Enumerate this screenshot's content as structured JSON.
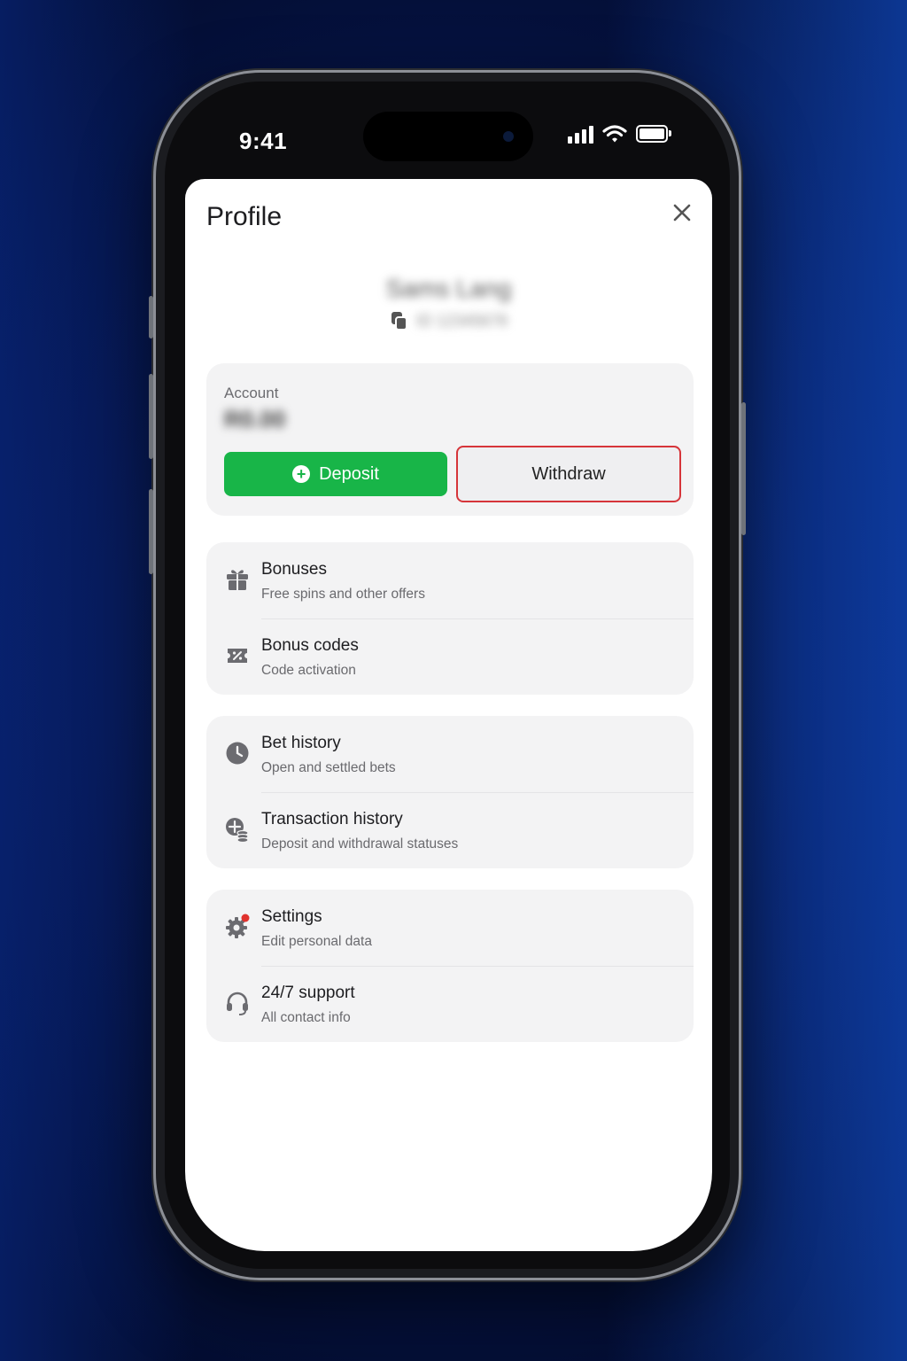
{
  "status_bar": {
    "time": "9:41"
  },
  "profile": {
    "title": "Profile",
    "user_name": "Sams Lang",
    "user_id": "ID 12345678"
  },
  "account": {
    "label": "Account",
    "balance": "R0.00",
    "deposit_label": "Deposit",
    "withdraw_label": "Withdraw"
  },
  "groups": [
    {
      "items": [
        {
          "icon": "gift-icon",
          "title": "Bonuses",
          "subtitle": "Free spins and other offers"
        },
        {
          "icon": "coupon-icon",
          "title": "Bonus codes",
          "subtitle": "Code activation"
        }
      ]
    },
    {
      "items": [
        {
          "icon": "clock-icon",
          "title": "Bet history",
          "subtitle": "Open and settled bets"
        },
        {
          "icon": "coins-icon",
          "title": "Transaction history",
          "subtitle": "Deposit and withdrawal statuses"
        }
      ]
    },
    {
      "items": [
        {
          "icon": "gear-icon",
          "title": "Settings",
          "subtitle": "Edit personal data"
        },
        {
          "icon": "headset-icon",
          "title": "24/7 support",
          "subtitle": "All contact info"
        }
      ]
    }
  ],
  "colors": {
    "deposit": "#18b548",
    "withdraw_border": "#d6353a",
    "notification_dot": "#e0322e",
    "background": "#06154a"
  }
}
